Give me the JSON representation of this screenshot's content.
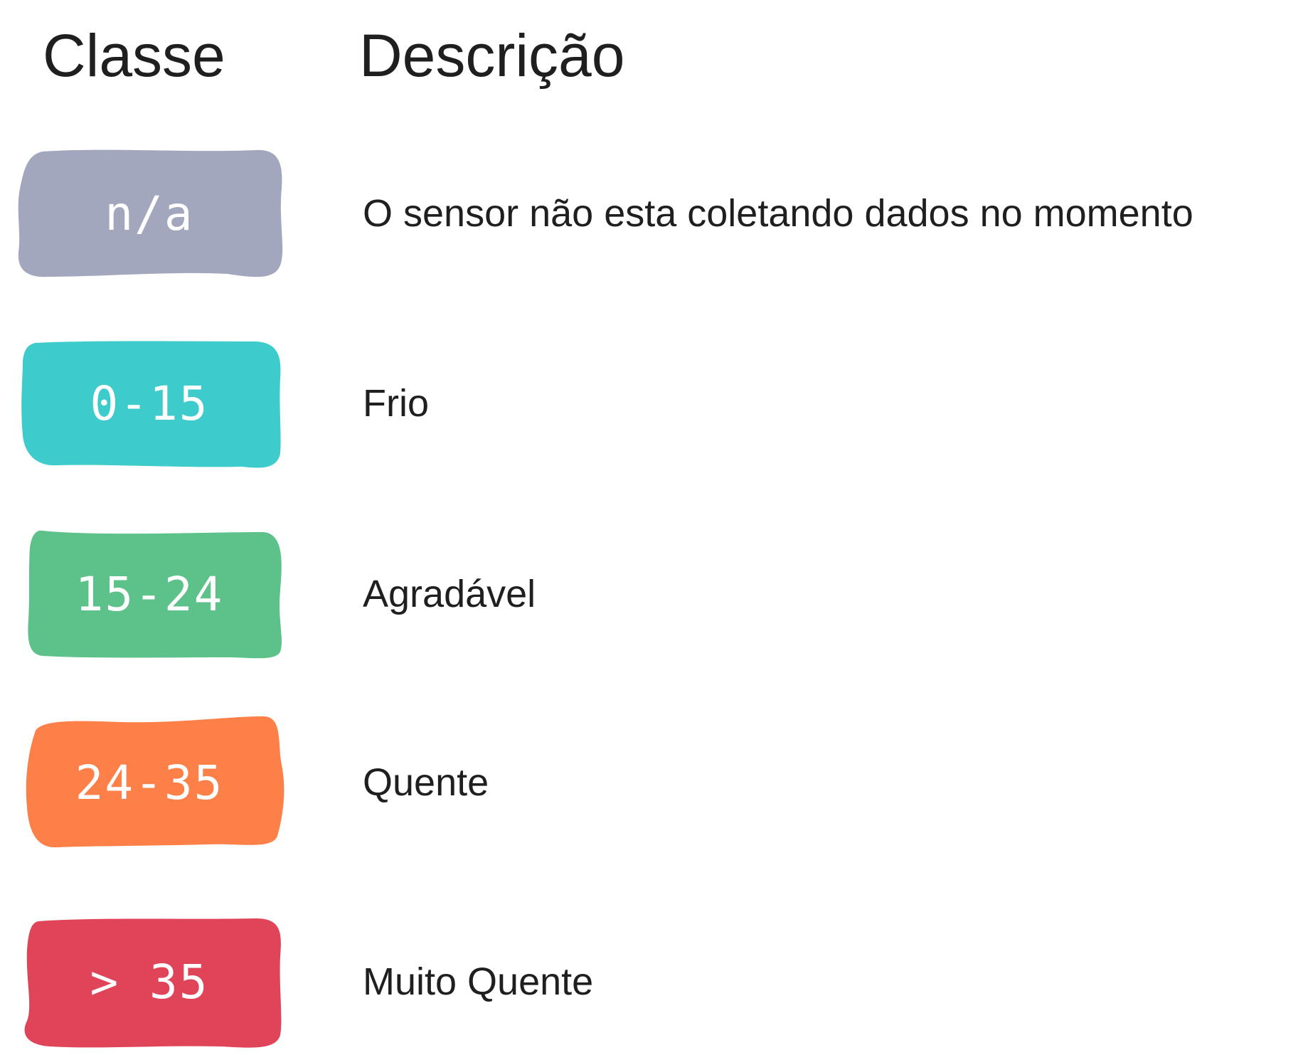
{
  "headers": {
    "class": "Classe",
    "description": "Descrição"
  },
  "rows": [
    {
      "badge": "n/a",
      "description": "O sensor não esta coletando dados no momento",
      "color": "#a3a7be"
    },
    {
      "badge": "0-15",
      "description": "Frio",
      "color": "#3dcccb"
    },
    {
      "badge": "15-24",
      "description": "Agradável",
      "color": "#5cc28a"
    },
    {
      "badge": "24-35",
      "description": "Quente",
      "color": "#fe8049"
    },
    {
      "badge": "> 35",
      "description": "Muito Quente",
      "color": "#e04458"
    }
  ]
}
